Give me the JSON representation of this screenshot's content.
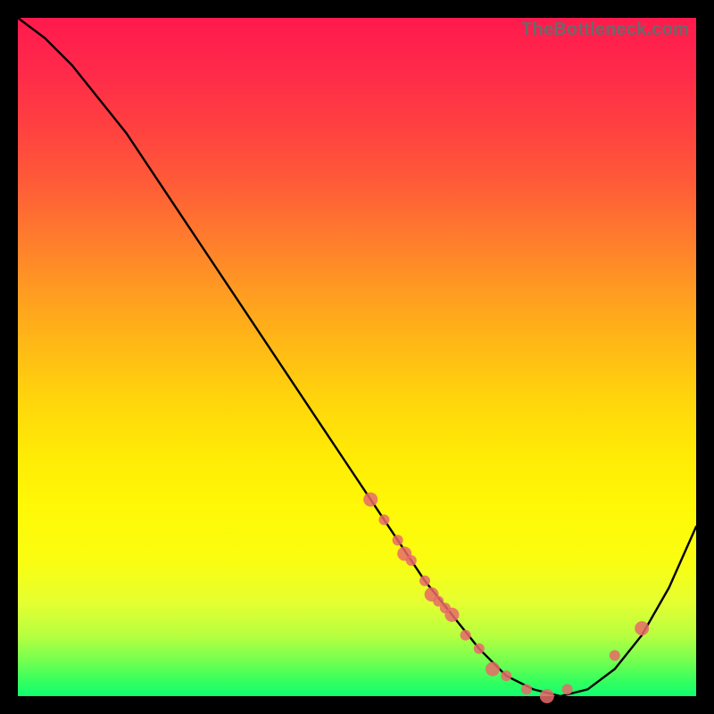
{
  "watermark": "TheBottleneck.com",
  "chart_data": {
    "type": "line",
    "title": "",
    "xlabel": "",
    "ylabel": "",
    "xlim": [
      0,
      100
    ],
    "ylim": [
      0,
      100
    ],
    "series": [
      {
        "name": "curve",
        "x": [
          0,
          4,
          8,
          12,
          16,
          20,
          24,
          28,
          32,
          36,
          40,
          44,
          48,
          52,
          56,
          60,
          64,
          68,
          72,
          76,
          80,
          84,
          88,
          92,
          96,
          100
        ],
        "y": [
          100,
          97,
          93,
          88,
          83,
          77,
          71,
          65,
          59,
          53,
          47,
          41,
          35,
          29,
          23,
          17,
          12,
          7,
          3,
          1,
          0,
          1,
          4,
          9,
          16,
          25
        ]
      }
    ],
    "markers": {
      "name": "samples",
      "x": [
        52,
        54,
        56,
        57,
        58,
        60,
        61,
        62,
        63,
        64,
        66,
        68,
        70,
        72,
        75,
        78,
        81,
        88,
        92
      ],
      "y": [
        29,
        26,
        23,
        21,
        20,
        17,
        15,
        14,
        13,
        12,
        9,
        7,
        4,
        3,
        1,
        0,
        1,
        6,
        10
      ]
    },
    "gradient_stops": [
      {
        "pos": 0,
        "color": "#ff1a4d"
      },
      {
        "pos": 50,
        "color": "#ffd400"
      },
      {
        "pos": 90,
        "color": "#d0ff30"
      },
      {
        "pos": 100,
        "color": "#10ff70"
      }
    ]
  }
}
